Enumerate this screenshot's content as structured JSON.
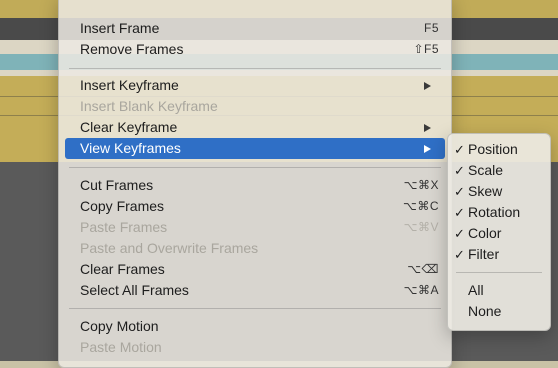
{
  "menu": {
    "items": [
      {
        "label": "Insert Frame",
        "shortcut": "F5"
      },
      {
        "label": "Remove Frames",
        "shortcut": "⇧F5"
      },
      {
        "label": "Insert Keyframe"
      },
      {
        "label": "Insert Blank Keyframe"
      },
      {
        "label": "Clear Keyframe"
      },
      {
        "label": "View Keyframes"
      },
      {
        "label": "Cut Frames",
        "shortcut": "⌥⌘X"
      },
      {
        "label": "Copy Frames",
        "shortcut": "⌥⌘C"
      },
      {
        "label": "Paste Frames",
        "shortcut": "⌥⌘V"
      },
      {
        "label": "Paste and Overwrite Frames"
      },
      {
        "label": "Clear Frames",
        "shortcut": "⌥⌫"
      },
      {
        "label": "Select All Frames",
        "shortcut": "⌥⌘A"
      },
      {
        "label": "Copy Motion"
      },
      {
        "label": "Paste Motion"
      }
    ]
  },
  "submenu": {
    "check_glyph": "✓",
    "items": [
      {
        "label": "Position"
      },
      {
        "label": "Scale"
      },
      {
        "label": "Skew"
      },
      {
        "label": "Rotation"
      },
      {
        "label": "Color"
      },
      {
        "label": "Filter"
      },
      {
        "label": "All"
      },
      {
        "label": "None"
      }
    ]
  }
}
